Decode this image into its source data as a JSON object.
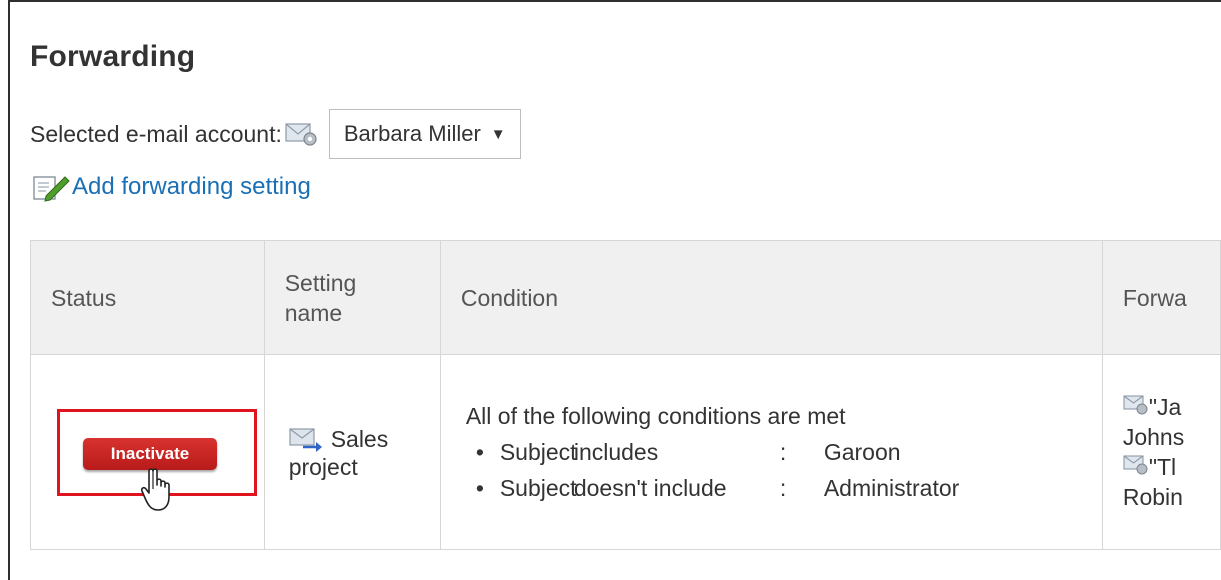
{
  "page": {
    "title": "Forwarding"
  },
  "account": {
    "label": "Selected e-mail account:",
    "selected": "Barbara Miller",
    "icon": "mail-settings-icon"
  },
  "add_link": {
    "label": "Add forwarding setting",
    "icon": "edit-icon"
  },
  "table": {
    "headers": {
      "status": "Status",
      "setting_name_1": "Setting",
      "setting_name_2": "name",
      "condition": "Condition",
      "forward_partial": "Forwa"
    },
    "rows": [
      {
        "status_button": "Inactivate",
        "setting_name_1": "Sales",
        "setting_name_2": "project",
        "condition_title": "All of the following conditions are met",
        "conditions": [
          {
            "bullet": "•",
            "field": "Subject",
            "operator": "includes",
            "colon": ":",
            "value": "Garoon"
          },
          {
            "bullet": "•",
            "field": "Subject",
            "operator": "doesn't include",
            "colon": ":",
            "value": "Administrator"
          }
        ],
        "forward_lines": [
          "\"Ja",
          "Johns",
          "\"Tl",
          "Robin"
        ]
      }
    ]
  },
  "colors": {
    "link": "#1a6fb5",
    "button": "#c4211f",
    "highlight": "#e0141e",
    "header_bg": "#f0f0f0"
  }
}
